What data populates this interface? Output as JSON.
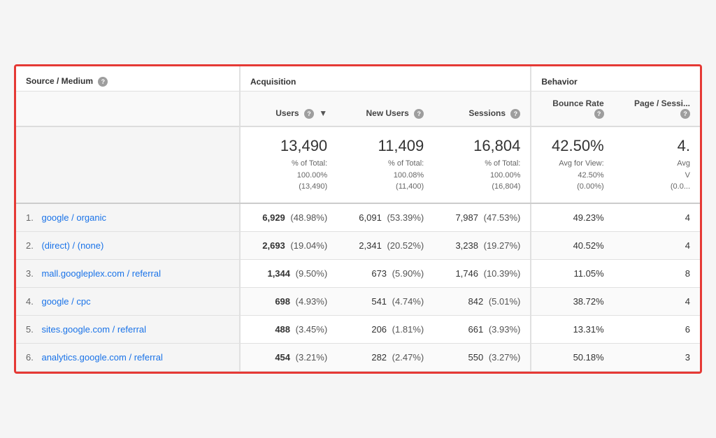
{
  "table": {
    "group_headers": {
      "source_medium": "Source / Medium",
      "acquisition": "Acquisition",
      "behavior": "Behavior"
    },
    "col_headers": {
      "source_medium": "Source / Medium",
      "users": "Users",
      "new_users": "New Users",
      "sessions": "Sessions",
      "bounce_rate": "Bounce Rate",
      "pages_per_session": "Page / Sessi..."
    },
    "summary": {
      "users_main": "13,490",
      "users_sub": "% of Total:\n100.00%\n(13,490)",
      "new_users_main": "11,409",
      "new_users_sub": "% of Total:\n100.08%\n(11,400)",
      "sessions_main": "16,804",
      "sessions_sub": "% of Total:\n100.00%\n(16,804)",
      "bounce_rate_main": "42.50%",
      "bounce_rate_sub": "Avg for View:\n42.50%\n(0.00%)",
      "pages_main": "4.",
      "pages_sub": "Avg\nV\n(0.0..."
    },
    "rows": [
      {
        "num": "1.",
        "source": "google / organic",
        "users_bold": "6,929",
        "users_pct": "(48.98%)",
        "new_users": "6,091",
        "new_users_pct": "(53.39%)",
        "sessions": "7,987",
        "sessions_pct": "(47.53%)",
        "bounce_rate": "49.23%",
        "pages": "4"
      },
      {
        "num": "2.",
        "source": "(direct) / (none)",
        "users_bold": "2,693",
        "users_pct": "(19.04%)",
        "new_users": "2,341",
        "new_users_pct": "(20.52%)",
        "sessions": "3,238",
        "sessions_pct": "(19.27%)",
        "bounce_rate": "40.52%",
        "pages": "4"
      },
      {
        "num": "3.",
        "source": "mall.googleplex.com / referral",
        "users_bold": "1,344",
        "users_pct": "(9.50%)",
        "new_users": "673",
        "new_users_pct": "(5.90%)",
        "sessions": "1,746",
        "sessions_pct": "(10.39%)",
        "bounce_rate": "11.05%",
        "pages": "8"
      },
      {
        "num": "4.",
        "source": "google / cpc",
        "users_bold": "698",
        "users_pct": "(4.93%)",
        "new_users": "541",
        "new_users_pct": "(4.74%)",
        "sessions": "842",
        "sessions_pct": "(5.01%)",
        "bounce_rate": "38.72%",
        "pages": "4"
      },
      {
        "num": "5.",
        "source": "sites.google.com / referral",
        "users_bold": "488",
        "users_pct": "(3.45%)",
        "new_users": "206",
        "new_users_pct": "(1.81%)",
        "sessions": "661",
        "sessions_pct": "(3.93%)",
        "bounce_rate": "13.31%",
        "pages": "6"
      },
      {
        "num": "6.",
        "source": "analytics.google.com / referral",
        "users_bold": "454",
        "users_pct": "(3.21%)",
        "new_users": "282",
        "new_users_pct": "(2.47%)",
        "sessions": "550",
        "sessions_pct": "(3.27%)",
        "bounce_rate": "50.18%",
        "pages": "3"
      }
    ]
  }
}
